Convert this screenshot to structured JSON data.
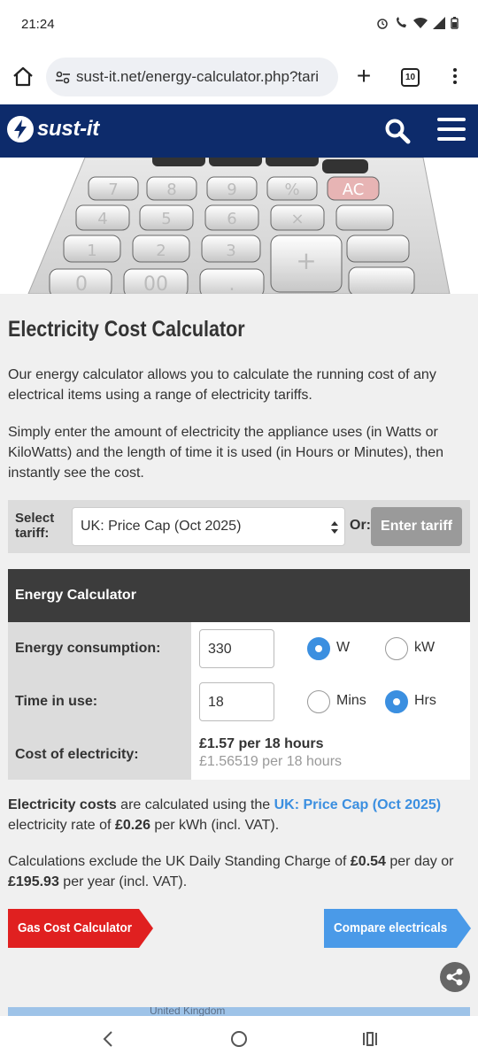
{
  "status_bar": {
    "time": "21:24"
  },
  "browser": {
    "url": "sust-it.net/energy-calculator.php?tari",
    "tab_count": "10"
  },
  "site": {
    "brand": "sust-it"
  },
  "hero": {
    "keys": [
      "7",
      "8",
      "9",
      "%",
      "AC",
      "4",
      "5",
      "6",
      "×",
      "1",
      "2",
      "3",
      "+",
      "0",
      "00",
      "."
    ]
  },
  "page": {
    "title": "Electricity Cost Calculator",
    "intro1": "Our energy calculator allows you to calculate the running cost of any electrical items using a range of electricity tariffs.",
    "intro2": "Simply enter the amount of electricity the appliance uses (in Watts or KiloWatts) and the length of time it is used (in Hours or Minutes), then instantly see the cost."
  },
  "tariff": {
    "label_line1": "Select",
    "label_line2": "tariff:",
    "selected": "UK: Price Cap (Oct 2025)",
    "or_label": "Or:",
    "enter_button": "Enter tariff"
  },
  "calculator": {
    "heading": "Energy Calculator",
    "consumption": {
      "label": "Energy consumption:",
      "value": "330",
      "unit_w": "W",
      "unit_kw": "kW",
      "selected_unit": "W"
    },
    "time": {
      "label": "Time in use:",
      "value": "18",
      "unit_mins": "Mins",
      "unit_hrs": "Hrs",
      "selected_unit": "Hrs"
    },
    "cost": {
      "label": "Cost of electricity:",
      "main": "£1.57 per 18 hours",
      "precise": "£1.56519 per 18 hours"
    }
  },
  "info": {
    "costs_bold": "Electricity costs",
    "costs_mid": " are calculated using the ",
    "tariff_link": "UK: Price Cap (Oct 2025)",
    "costs_tail": " electricity rate of ",
    "rate": "£0.26",
    "rate_tail": " per kWh (incl. VAT).",
    "exclude_start": "Calculations exclude the UK Daily Standing Charge of ",
    "standing_day": "£0.54",
    "exclude_mid": " per day or ",
    "standing_year": "£195.93",
    "exclude_tail": " per year (incl. VAT)."
  },
  "buttons": {
    "gas": "Gas Cost Calculator",
    "compare": "Compare electricals"
  },
  "map": {
    "label": "United Kingdom"
  },
  "colors": {
    "header_bg": "#0d2b6b",
    "accent_blue": "#3b8fe0",
    "gas_red": "#e02020",
    "compare_blue": "#4a9ae8"
  }
}
